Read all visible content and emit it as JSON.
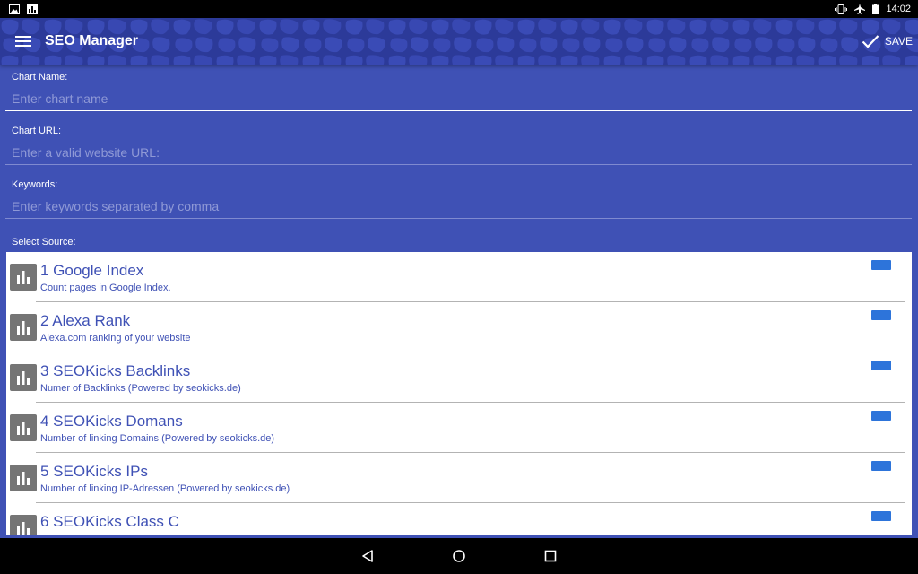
{
  "status_bar": {
    "time": "14:02",
    "left_icons": [
      "image-icon",
      "chart-icon"
    ],
    "right_icons": [
      "vibrate-icon",
      "airplane-icon",
      "battery-icon"
    ]
  },
  "toolbar": {
    "title": "SEO Manager",
    "save_label": "SAVE",
    "menu_icon": "menu-icon",
    "save_icon": "check-icon",
    "color": "#2f3e9e"
  },
  "form": {
    "chart_name": {
      "label": "Chart Name:",
      "value": "",
      "placeholder": "Enter chart name"
    },
    "chart_url": {
      "label": "Chart URL:",
      "value": "",
      "placeholder": "Enter a valid website URL:"
    },
    "keywords": {
      "label": "Keywords:",
      "value": "",
      "placeholder": "Enter keywords separated by comma"
    },
    "source_label": "Select Source:"
  },
  "sources": [
    {
      "name": "1 Google Index",
      "description": "Count pages in Google Index.",
      "icon": "bar-chart-icon",
      "enabled": true
    },
    {
      "name": "2 Alexa Rank",
      "description": "Alexa.com ranking of your website",
      "icon": "bar-chart-icon",
      "enabled": true
    },
    {
      "name": "3 SEOKicks Backlinks",
      "description": "Numer of Backlinks (Powered by seokicks.de)",
      "icon": "bar-chart-icon",
      "enabled": true
    },
    {
      "name": "4 SEOKicks Domans",
      "description": "Number of linking Domains (Powered by seokicks.de)",
      "icon": "bar-chart-icon",
      "enabled": true
    },
    {
      "name": "5 SEOKicks IPs",
      "description": "Number of linking IP-Adressen (Powered by seokicks.de)",
      "icon": "bar-chart-icon",
      "enabled": true
    },
    {
      "name": "6 SEOKicks Class C",
      "description": "",
      "icon": "bar-chart-icon",
      "enabled": true
    }
  ],
  "nav_bar": {
    "icons": [
      "back-icon",
      "home-icon",
      "recents-icon"
    ]
  },
  "colors": {
    "background": "#3f51b5",
    "accent_text": "#3f51b5",
    "toggle": "#2d74da"
  }
}
